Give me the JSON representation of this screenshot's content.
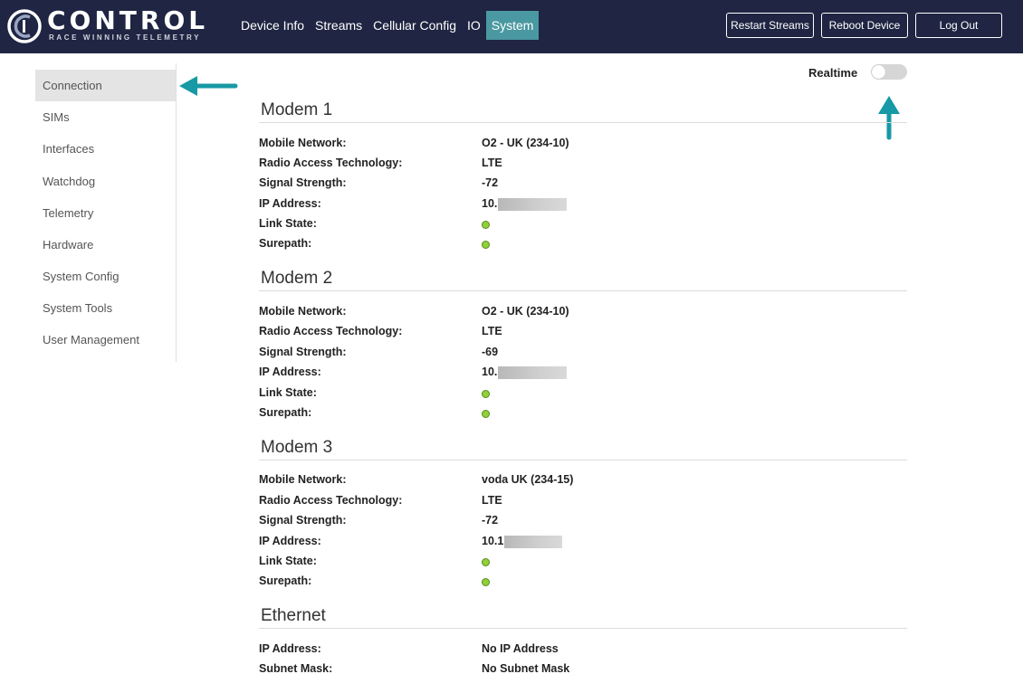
{
  "header": {
    "brand": "CONTROL",
    "tagline": "RACE WINNING TELEMETRY",
    "logo_icon": "control-logo-icon",
    "nav": [
      {
        "label": "Device Info"
      },
      {
        "label": "Streams"
      },
      {
        "label": "Cellular Config"
      },
      {
        "label": "IO"
      },
      {
        "label": "System",
        "active": true
      }
    ],
    "buttons": {
      "restart": "Restart Streams",
      "reboot": "Reboot Device",
      "logout": "Log Out"
    },
    "bg_color": "#1f2542",
    "active_color": "#4a98a1"
  },
  "sidebar": {
    "items": [
      {
        "label": "Connection",
        "active": true
      },
      {
        "label": "SIMs"
      },
      {
        "label": "Interfaces"
      },
      {
        "label": "Watchdog"
      },
      {
        "label": "Telemetry"
      },
      {
        "label": "Hardware"
      },
      {
        "label": "System Config"
      },
      {
        "label": "System Tools"
      },
      {
        "label": "User Management"
      }
    ]
  },
  "realtime": {
    "label": "Realtime",
    "enabled": false
  },
  "annotation_color": "#1799a6",
  "status_dot_color": "#8fd136",
  "modems": [
    {
      "title": "Modem 1",
      "labels": {
        "network": "Mobile Network:",
        "rat": "Radio Access Technology:",
        "signal": "Signal Strength:",
        "ip": "IP Address:",
        "link": "Link State:",
        "surepath": "Surepath:"
      },
      "network": "O2 - UK (234-10)",
      "rat": "LTE",
      "signal": "-72",
      "ip": "10.",
      "link_state": "ok",
      "surepath": "ok"
    },
    {
      "title": "Modem 2",
      "labels": {
        "network": "Mobile Network:",
        "rat": "Radio Access Technology:",
        "signal": "Signal Strength:",
        "ip": "IP Address:",
        "link": "Link State:",
        "surepath": "Surepath:"
      },
      "network": "O2 - UK (234-10)",
      "rat": "LTE",
      "signal": "-69",
      "ip": "10.",
      "link_state": "ok",
      "surepath": "ok"
    },
    {
      "title": "Modem 3",
      "labels": {
        "network": "Mobile Network:",
        "rat": "Radio Access Technology:",
        "signal": "Signal Strength:",
        "ip": "IP Address:",
        "link": "Link State:",
        "surepath": "Surepath:"
      },
      "network": "voda UK (234-15)",
      "rat": "LTE",
      "signal": "-72",
      "ip": "10.1",
      "link_state": "ok",
      "surepath": "ok"
    }
  ],
  "ethernet": {
    "title": "Ethernet",
    "labels": {
      "ip": "IP Address:",
      "subnet": "Subnet Mask:"
    },
    "ip": "No IP Address",
    "subnet": "No Subnet Mask"
  }
}
